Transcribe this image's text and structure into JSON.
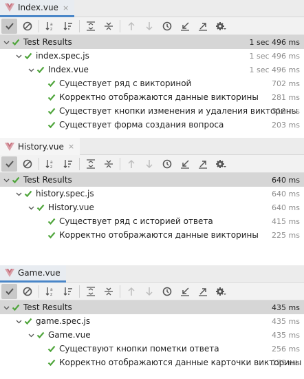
{
  "colors": {
    "accent": "#4a86c8",
    "pass": "#4fa53b",
    "root_row_bg": "#d6d6d6"
  },
  "toolbar": {
    "buttons": [
      "show-passed-icon",
      "show-ignored-icon",
      "sort-alphabetically-icon",
      "sort-by-duration-icon",
      "expand-all-icon",
      "collapse-all-icon",
      "previous-failed-icon",
      "next-failed-icon",
      "history-icon",
      "import-tests-icon",
      "export-tests-icon",
      "settings-icon"
    ]
  },
  "panels": [
    {
      "tab": {
        "label": "Index.vue",
        "close": "×",
        "icon": "vue-icon"
      },
      "root": {
        "label": "Test Results",
        "duration": "1 sec 496 ms"
      },
      "spec": {
        "label": "index.spec.js",
        "duration": "1 sec 496 ms"
      },
      "suite": {
        "label": "Index.vue",
        "duration": "1 sec 496 ms"
      },
      "tests": [
        {
          "label": "Существует ряд с викториной",
          "duration": "702 ms"
        },
        {
          "label": "Корректно отображаются данные викторины",
          "duration": "281 ms"
        },
        {
          "label": "Существует кнопки изменения и удаления викторины",
          "duration": "310 ms"
        },
        {
          "label": "Существует форма создания вопроса",
          "duration": "203 ms"
        }
      ]
    },
    {
      "tab": {
        "label": "History.vue",
        "close": "×",
        "icon": "vue-icon"
      },
      "root": {
        "label": "Test Results",
        "duration": "640 ms"
      },
      "spec": {
        "label": "history.spec.js",
        "duration": "640 ms"
      },
      "suite": {
        "label": "History.vue",
        "duration": "640 ms"
      },
      "tests": [
        {
          "label": "Существует ряд с историей ответа",
          "duration": "415 ms"
        },
        {
          "label": "Корректно отображаются данные викторины",
          "duration": "225 ms"
        }
      ]
    },
    {
      "tab": {
        "label": "Game.vue",
        "close": "",
        "icon": "vue-icon"
      },
      "root": {
        "label": "Test Results",
        "duration": "435 ms"
      },
      "spec": {
        "label": "game.spec.js",
        "duration": "435 ms"
      },
      "suite": {
        "label": "Game.vue",
        "duration": "435 ms"
      },
      "tests": [
        {
          "label": "Существуют кнопки пометки ответа",
          "duration": "256 ms"
        },
        {
          "label": "Корректно отображаются данные карточки викторины",
          "duration": "179 ms"
        }
      ]
    }
  ]
}
